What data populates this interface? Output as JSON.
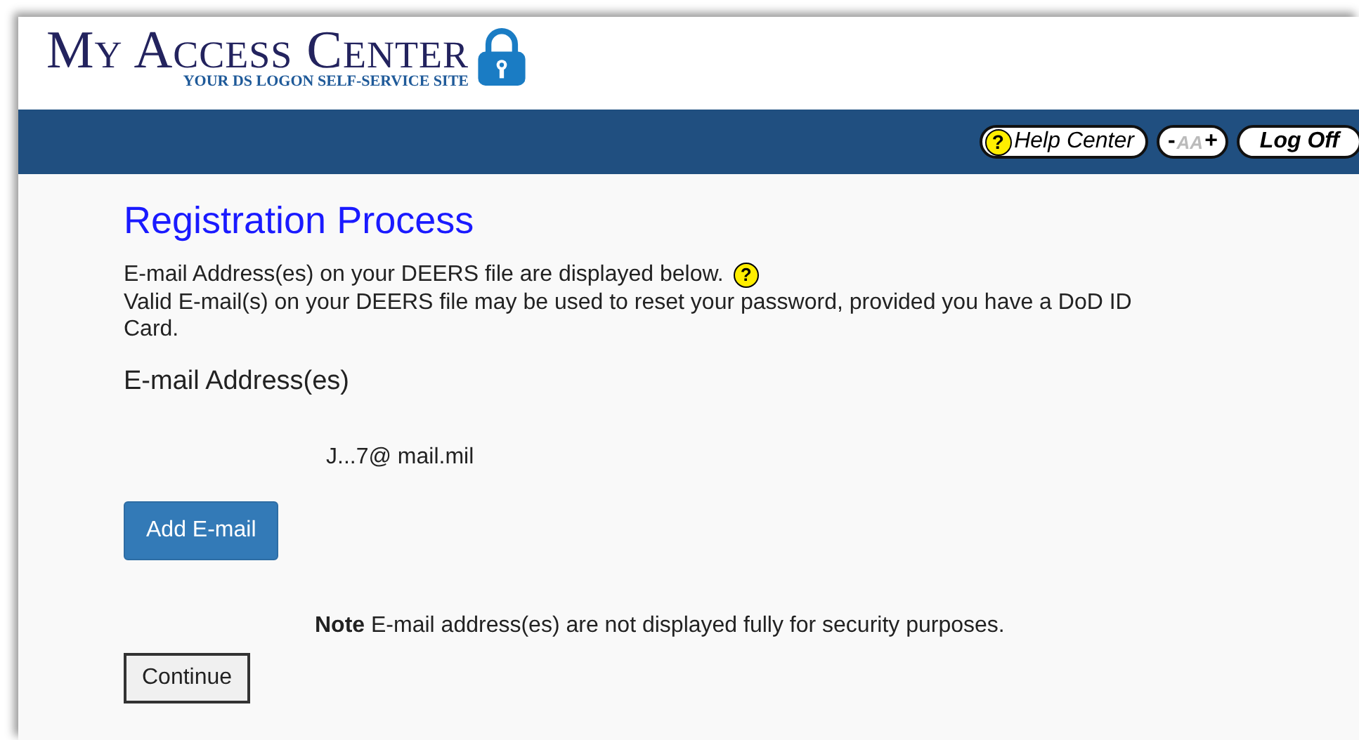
{
  "header": {
    "title": "My Access Center",
    "subtitle": "YOUR DS LOGON SELF-SERVICE SITE"
  },
  "nav": {
    "help": {
      "icon": "?",
      "label": "Help Center"
    },
    "font_size": {
      "minus": "-",
      "label": "AA",
      "plus": "+"
    },
    "logoff": "Log Off"
  },
  "page": {
    "heading": "Registration Process",
    "intro": "E-mail Address(es) on your DEERS file are displayed below.",
    "help_icon": "?",
    "info": "Valid E-mail(s) on your DEERS file may be used to reset your password, provided you have a DoD ID Card.",
    "section": "E-mail Address(es)",
    "emails": [
      "J...7@ mail.mil"
    ],
    "add_button": "Add E-mail",
    "note": "**Note** E-mail address(es) are not displayed fully for security purposes.",
    "continue_button": "Continue"
  }
}
